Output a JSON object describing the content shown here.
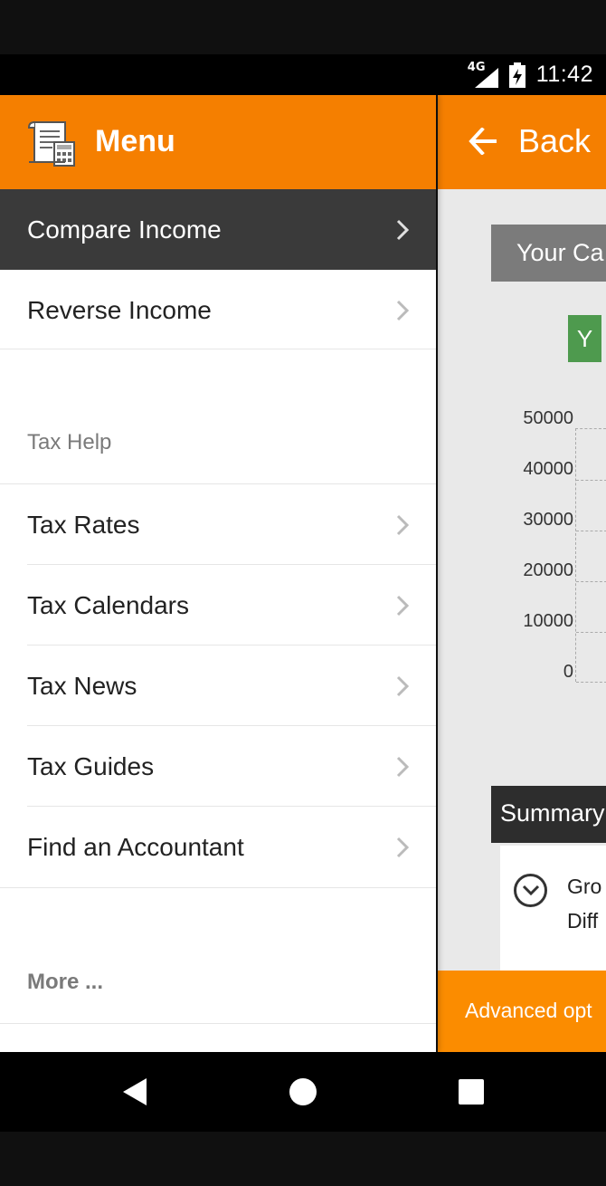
{
  "status_bar": {
    "network_label": "4G",
    "time": "11:42"
  },
  "drawer": {
    "title": "Menu",
    "logo_icon": "tax-document-calculator-icon",
    "items": [
      {
        "label": "Compare Income",
        "active": true
      },
      {
        "label": "Reverse Income",
        "active": false
      }
    ],
    "tax_help_label": "Tax Help",
    "tax_help_items": [
      {
        "label": "Tax Rates"
      },
      {
        "label": "Tax Calendars"
      },
      {
        "label": "Tax News"
      },
      {
        "label": "Tax Guides"
      },
      {
        "label": "Find an Accountant"
      }
    ],
    "more_label": "More ..."
  },
  "background_screen": {
    "back_label": "Back",
    "section_title": "Your Ca",
    "legend_label": "Y",
    "y_ticks": [
      "50000",
      "40000",
      "30000",
      "20000",
      "10000",
      "0"
    ],
    "summary_title": "Summary",
    "summary_line1": "Gro",
    "summary_line2": "Diff",
    "advanced_label": "Advanced opt"
  },
  "colors": {
    "accent": "#f57f00",
    "active_item": "#3a3a3a",
    "legend_green": "#4e9a4e"
  }
}
